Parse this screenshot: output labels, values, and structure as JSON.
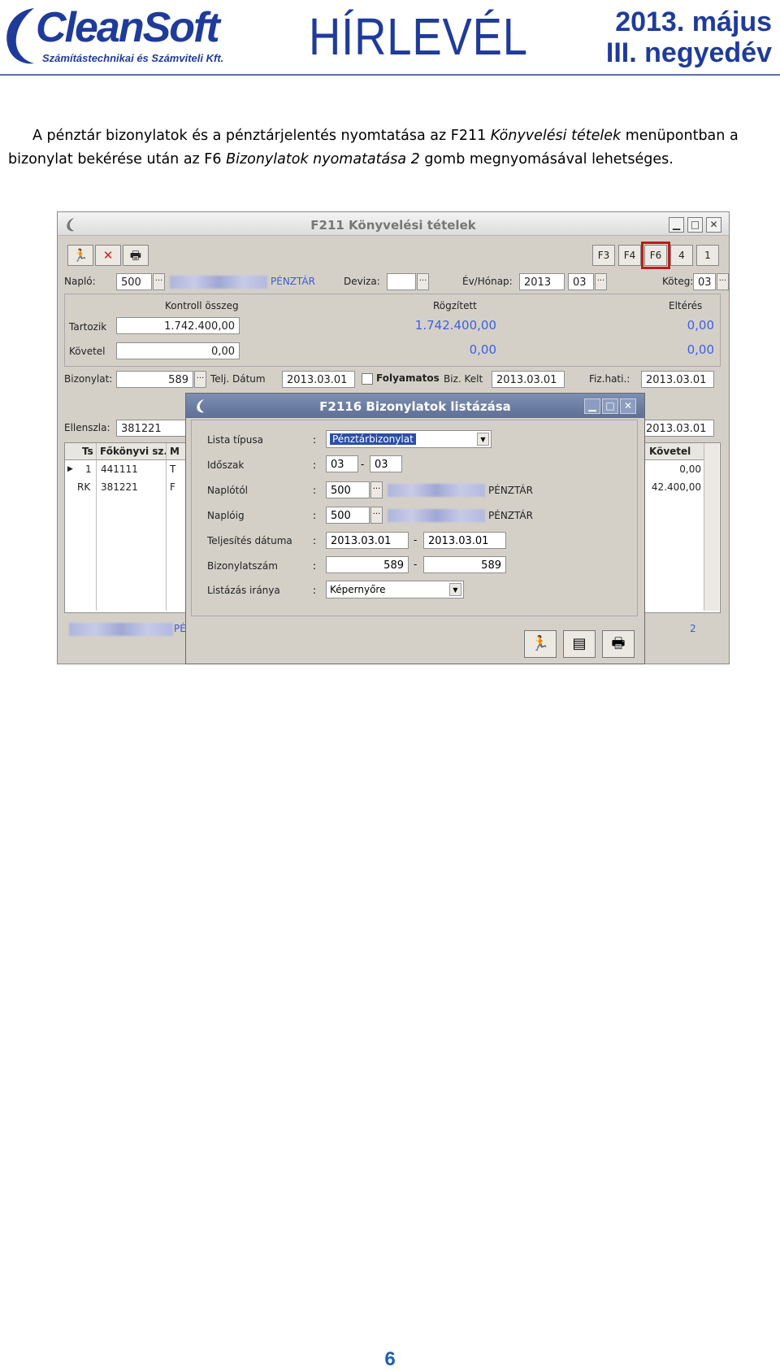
{
  "header": {
    "logo_text": "CleanSoft",
    "logo_subtitle": "Számítástechnikai és Számviteli Kft.",
    "title": "HÍRLEVÉL",
    "date_line1": "2013. május",
    "date_line2": "III. negyedév"
  },
  "body": {
    "l1_a": "A pénztár bizonylatok és a pénztárjelentés nyomtatása az F211 ",
    "l1_em": "Könyvelési tételek",
    "l1_b": " menüpontban a",
    "l2_a": "bizonylat bekérése után az F6 ",
    "l2_em": "Bizonylatok nyomatatása 2",
    "l2_b": " gomb megnyomásával lehetséges."
  },
  "page_number": "6",
  "window": {
    "title": "F211 Könyvelési tételek",
    "min": "▁",
    "max": "□",
    "close": "✕",
    "fkeys": [
      "F3",
      "F4",
      "F6",
      "4",
      "1"
    ],
    "naplo_label": "Napló:",
    "naplo_value": "500",
    "naplo_name": "PÉNZTÁR",
    "deviza_label": "Deviza:",
    "evhonap_label": "Év/Hónap:",
    "ev_value": "2013",
    "honap_value": "03",
    "koteg_label": "Köteg:",
    "koteg_value": "03",
    "kontroll_label": "Kontroll összeg",
    "rogzitett_label": "Rögzített",
    "elteres_label": "Eltérés",
    "tartozik_label": "Tartozik",
    "tartozik_value": "1.742.400,00",
    "tartozik_rogzitett": "1.742.400,00",
    "tartozik_elteres": "0,00",
    "kovetel_label": "Követel",
    "kovetel_value": "0,00",
    "kovetel_rogzitett": "0,00",
    "kovetel_elteres": "0,00",
    "bizonylat_label": "Bizonylat:",
    "bizonylat_value": "589",
    "telj_label": "Telj. Dátum",
    "telj_value": "2013.03.01",
    "folyamatos_label": "Folyamatos",
    "bizkelt_label": "Biz. Kelt",
    "bizkelt_value": "2013.03.01",
    "fizhati_label": "Fiz.hati.:",
    "fizhati_value": "2013.03.01",
    "ellenszla_label": "Ellenszla:",
    "ellenszla_value": "381221",
    "right_date": "2013.03.01",
    "grid_cols": [
      "Ts",
      "Főkönyvi sz.",
      "M",
      "Követel"
    ],
    "grid_rows": [
      {
        "ts": "1",
        "fokonyv": "441111",
        "m": "T",
        "kovetel": "0,00"
      },
      {
        "ts": "RK",
        "fokonyv": "381221",
        "m": "F",
        "kovetel": "42.400,00"
      }
    ],
    "footer_name_frag": "PÉ",
    "footer_count": "2"
  },
  "dialog": {
    "title": "F2116 Bizonylatok listázása",
    "lista_label": "Lista típusa",
    "lista_value": "Pénztárbizonylat",
    "idoszak_label": "Időszak",
    "idoszak_from": "03",
    "idoszak_to": "03",
    "naplotol_label": "Naplótól",
    "naplotol_value": "500",
    "naplotol_name": "PÉNZTÁR",
    "naploig_label": "Naplóig",
    "naploig_value": "500",
    "naploig_name": "PÉNZTÁR",
    "teljesites_label": "Teljesítés dátuma",
    "teljesites_from": "2013.03.01",
    "teljesites_to": "2013.03.01",
    "bizszam_label": "Bizonylatszám",
    "bizszam_from": "589",
    "bizszam_to": "589",
    "irany_label": "Listázás iránya",
    "irany_value": "Képernyőre",
    "colon": ":",
    "dash": "-"
  }
}
